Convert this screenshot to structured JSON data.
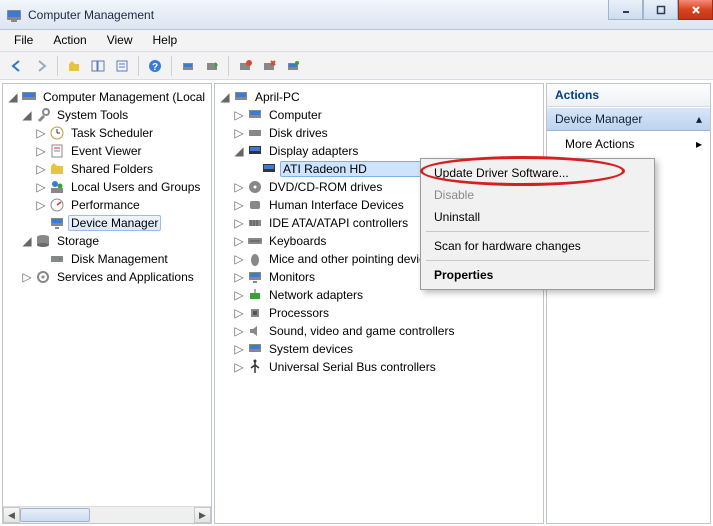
{
  "window": {
    "title": "Computer Management"
  },
  "menu": {
    "file": "File",
    "action": "Action",
    "view": "View",
    "help": "Help"
  },
  "left_tree": {
    "root": "Computer Management (Local",
    "system_tools": "System Tools",
    "task_scheduler": "Task Scheduler",
    "event_viewer": "Event Viewer",
    "shared_folders": "Shared Folders",
    "local_users": "Local Users and Groups",
    "performance": "Performance",
    "device_manager": "Device Manager",
    "storage": "Storage",
    "disk_management": "Disk Management",
    "services_apps": "Services and Applications"
  },
  "mid_tree": {
    "root": "April-PC",
    "computer": "Computer",
    "disk_drives": "Disk drives",
    "display_adapters": "Display adapters",
    "display_device": "ATI Radeon HD",
    "dvd": "DVD/CD-ROM drives",
    "hid": "Human Interface Devices",
    "ide": "IDE ATA/ATAPI controllers",
    "keyboards": "Keyboards",
    "mice": "Mice and other pointing devices",
    "monitors": "Monitors",
    "net": "Network adapters",
    "processors": "Processors",
    "sound": "Sound, video and game controllers",
    "system_devices": "System devices",
    "usb": "Universal Serial Bus controllers"
  },
  "context_menu": {
    "update": "Update Driver Software...",
    "disable": "Disable",
    "uninstall": "Uninstall",
    "scan": "Scan for hardware changes",
    "properties": "Properties"
  },
  "actions": {
    "header": "Actions",
    "section": "Device Manager",
    "more": "More Actions"
  }
}
